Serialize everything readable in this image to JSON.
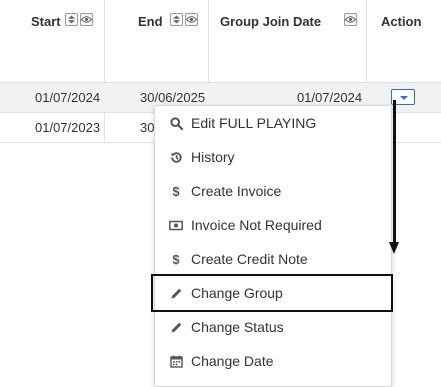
{
  "table": {
    "columns": [
      {
        "label": "Start"
      },
      {
        "label": "End"
      },
      {
        "label": "Group Join Date"
      },
      {
        "label": "Action"
      }
    ],
    "rows": [
      {
        "start": "01/07/2024",
        "end": "30/06/2025",
        "join_date": "01/07/2024"
      },
      {
        "start": "01/07/2023",
        "end": "30",
        "join_date": ""
      }
    ]
  },
  "icons": {
    "sort": "sort-icon",
    "visibility": "eye-icon",
    "dropdown": "chevron-down-icon"
  },
  "action_menu": {
    "items": [
      {
        "label": "Edit FULL PLAYING",
        "icon": "search-icon"
      },
      {
        "label": "History",
        "icon": "history-icon"
      },
      {
        "label": "Create Invoice",
        "icon": "dollar-icon"
      },
      {
        "label": "Invoice Not Required",
        "icon": "money-icon"
      },
      {
        "label": "Create Credit Note",
        "icon": "dollar-icon"
      },
      {
        "label": "Change Group",
        "icon": "pencil-icon"
      },
      {
        "label": "Change Status",
        "icon": "pencil-icon"
      },
      {
        "label": "Change Date",
        "icon": "calendar-icon"
      }
    ]
  },
  "annotation": {
    "highlighted_item": "Change Group",
    "accent_color": "#111111"
  },
  "colors": {
    "button_border": "#2a6fd6",
    "row_alt_bg": "#f2f2f2"
  }
}
